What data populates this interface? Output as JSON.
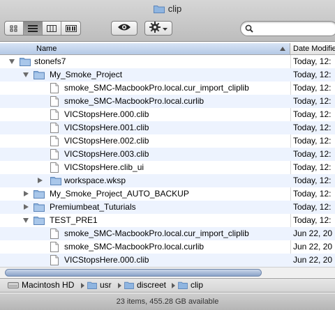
{
  "window": {
    "title": "clip"
  },
  "toolbar": {
    "views": [
      "icon-view-icon",
      "list-view-icon",
      "column-view-icon",
      "coverflow-view-icon"
    ],
    "active_view": 1,
    "quicklook_icon": "eye-icon",
    "action_icon": "gear-icon",
    "search": {
      "placeholder": "",
      "icon": "search-icon"
    }
  },
  "columns": {
    "name": "Name",
    "date": "Date Modified"
  },
  "rows": [
    {
      "name": "stonefs7",
      "date": "Today, 12:",
      "kind": "folder",
      "indent": 0,
      "disclosure": "open"
    },
    {
      "name": "My_Smoke_Project",
      "date": "Today, 12:",
      "kind": "folder",
      "indent": 1,
      "disclosure": "open"
    },
    {
      "name": "smoke_SMC-MacbookPro.local.cur_import_cliplib",
      "date": "Today, 12:",
      "kind": "file",
      "indent": 2,
      "disclosure": "none"
    },
    {
      "name": "smoke_SMC-MacbookPro.local.curlib",
      "date": "Today, 12:",
      "kind": "file",
      "indent": 2,
      "disclosure": "none"
    },
    {
      "name": "VICStopsHere.000.clib",
      "date": "Today, 12:",
      "kind": "file",
      "indent": 2,
      "disclosure": "none"
    },
    {
      "name": "VICStopsHere.001.clib",
      "date": "Today, 12:",
      "kind": "file",
      "indent": 2,
      "disclosure": "none"
    },
    {
      "name": "VICStopsHere.002.clib",
      "date": "Today, 12:",
      "kind": "file",
      "indent": 2,
      "disclosure": "none"
    },
    {
      "name": "VICStopsHere.003.clib",
      "date": "Today, 12:",
      "kind": "file",
      "indent": 2,
      "disclosure": "none"
    },
    {
      "name": "VICStopsHere.clib_ui",
      "date": "Today, 12:",
      "kind": "file",
      "indent": 2,
      "disclosure": "none"
    },
    {
      "name": "workspace.wksp",
      "date": "Today, 12:",
      "kind": "folder",
      "indent": 2,
      "disclosure": "closed"
    },
    {
      "name": "My_Smoke_Project_AUTO_BACKUP",
      "date": "Today, 12:",
      "kind": "folder",
      "indent": 1,
      "disclosure": "closed"
    },
    {
      "name": "Premiumbeat_Tuturials",
      "date": "Today, 12:",
      "kind": "folder",
      "indent": 1,
      "disclosure": "closed"
    },
    {
      "name": "TEST_PRE1",
      "date": "Today, 12:",
      "kind": "folder",
      "indent": 1,
      "disclosure": "open"
    },
    {
      "name": "smoke_SMC-MacbookPro.local.cur_import_cliplib",
      "date": "Jun 22, 20",
      "kind": "file",
      "indent": 2,
      "disclosure": "none"
    },
    {
      "name": "smoke_SMC-MacbookPro.local.curlib",
      "date": "Jun 22, 20",
      "kind": "file",
      "indent": 2,
      "disclosure": "none"
    },
    {
      "name": "VICStopsHere.000.clib",
      "date": "Jun 22, 20",
      "kind": "file",
      "indent": 2,
      "disclosure": "none"
    }
  ],
  "path": [
    {
      "label": "Macintosh HD",
      "icon": "hard-drive-icon"
    },
    {
      "label": "usr",
      "icon": "folder-icon"
    },
    {
      "label": "discreet",
      "icon": "folder-icon"
    },
    {
      "label": "clip",
      "icon": "folder-icon"
    }
  ],
  "status": "23 items, 455.28 GB available",
  "colors": {
    "folder": "#7ea8d8",
    "stripe": "#edf3fe",
    "header_selected": "#c4d5ee"
  }
}
